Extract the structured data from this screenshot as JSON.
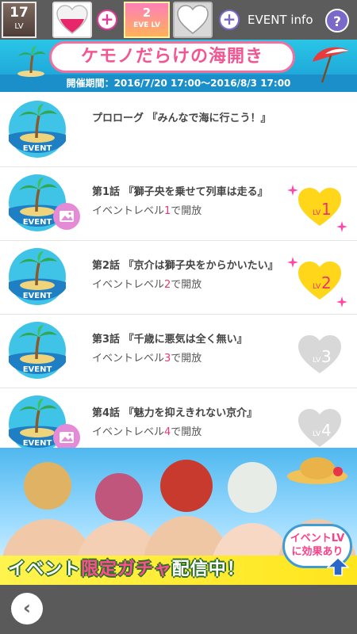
{
  "topbar": {
    "player_level": "17",
    "player_level_label": "LV",
    "event_level": "2",
    "event_level_label": "EVE LV",
    "plus_symbol": "+",
    "event_info_label": "EVENT info",
    "help_symbol": "?"
  },
  "banner": {
    "title": "ケモノだらけの海開き",
    "period": "開催期間：2016/7/20 17:00〜2016/8/3 17:00"
  },
  "episodes": [
    {
      "title": "プロローグ 『みんなで海に行こう！』",
      "requirement": "",
      "required_level": "",
      "badge_text": "EVENT",
      "has_thumbnail": false,
      "status": "unlocked"
    },
    {
      "title": "第1話 『獅子央を乗せて列車は走る』",
      "requirement_prefix": "イベントレベル",
      "required_level": "1",
      "requirement_suffix": "で開放",
      "badge_text": "EVENT",
      "lv_label": "LV",
      "has_thumbnail": true,
      "status": "unlocked"
    },
    {
      "title": "第2話 『京介は獅子央をからかいたい』",
      "requirement_prefix": "イベントレベル",
      "required_level": "2",
      "requirement_suffix": "で開放",
      "badge_text": "EVENT",
      "lv_label": "LV",
      "has_thumbnail": false,
      "status": "unlocked"
    },
    {
      "title": "第3話 『千歳に悪気は全く無い』",
      "requirement_prefix": "イベントレベル",
      "required_level": "3",
      "requirement_suffix": "で開放",
      "badge_text": "EVENT",
      "lv_label": "LV",
      "has_thumbnail": false,
      "status": "locked"
    },
    {
      "title": "第4話 『魅力を抑えきれない京介』",
      "requirement_prefix": "イベントレベル",
      "required_level": "4",
      "requirement_suffix": "で開放",
      "badge_text": "EVENT",
      "lv_label": "LV",
      "has_thumbnail": true,
      "status": "locked"
    }
  ],
  "gacha": {
    "text_part1": "イベント",
    "text_highlight": "限定ガチャ",
    "text_part2": "配信中！",
    "badge_line1": "イベントLV",
    "badge_line2": "に効果あり"
  },
  "bottom": {
    "back_symbol": "‹"
  },
  "colors": {
    "unlocked_heart": "#ffd61a",
    "locked_heart": "#d8d8d8",
    "accent_pink": "#ea3a6d"
  }
}
